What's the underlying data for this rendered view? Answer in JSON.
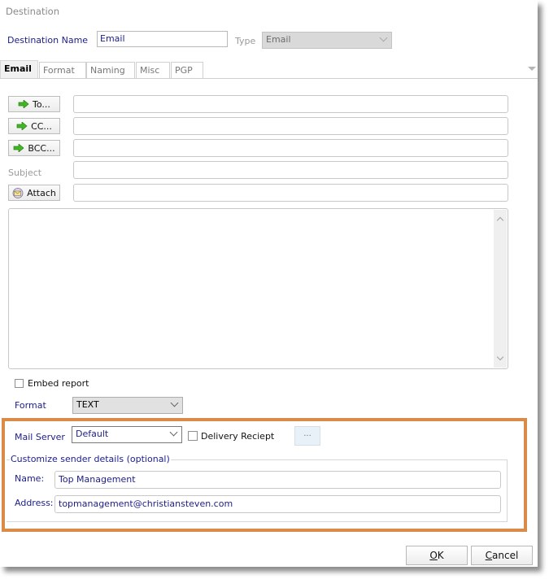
{
  "window": {
    "title": "Destination"
  },
  "destination": {
    "name_label": "Destination Name",
    "name_value": "Email",
    "type_label": "Type",
    "type_value": "Email"
  },
  "tabs": [
    {
      "label": "Email",
      "active": true
    },
    {
      "label": "Format",
      "active": false
    },
    {
      "label": "Naming",
      "active": false
    },
    {
      "label": "Misc",
      "active": false
    },
    {
      "label": "PGP",
      "active": false
    }
  ],
  "email": {
    "to_button": "To...",
    "to_value": "",
    "cc_button": "CC...",
    "cc_value": "",
    "bcc_button": "BCC...",
    "bcc_value": "",
    "subject_label": "Subject",
    "subject_value": "",
    "attach_button": "Attach",
    "attach_value": "",
    "body_value": "",
    "embed_report_label": "Embed report",
    "embed_report_checked": false,
    "format_label": "Format",
    "format_value": "TEXT"
  },
  "mail_server": {
    "label": "Mail Server",
    "value": "Default",
    "delivery_receipt_label": "Delivery Reciept",
    "delivery_receipt_checked": false,
    "browse_label": "..."
  },
  "sender": {
    "group_title": "Customize sender details (optional)",
    "name_label": "Name:",
    "name_value": "Top Management",
    "address_label": "Address:",
    "address_value": "topmanagement@christiansteven.com"
  },
  "footer": {
    "ok_mnemonic": "O",
    "ok_rest": "K",
    "cancel_mnemonic": "C",
    "cancel_rest": "ancel"
  },
  "colors": {
    "highlight": "#d98c4a",
    "label_blue": "#1c1c8c",
    "arrow_green": "#3fb824"
  }
}
